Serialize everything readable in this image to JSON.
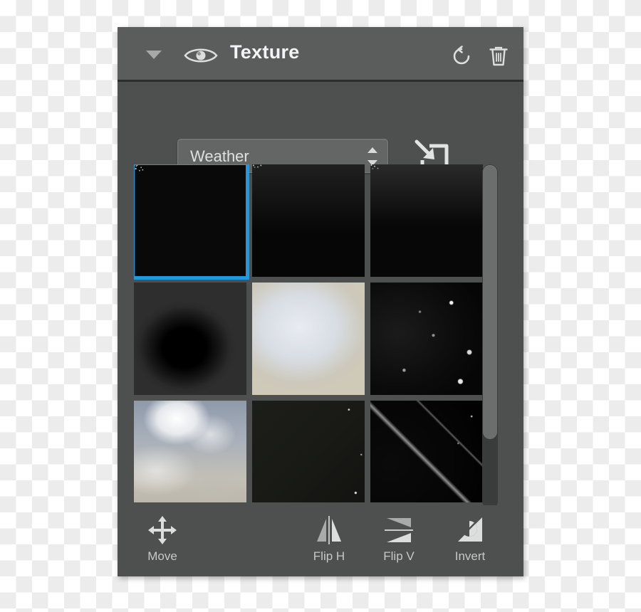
{
  "panel": {
    "header": {
      "title": "Texture",
      "disclosure_icon": "chevron-down-icon",
      "visibility_icon": "eye-icon",
      "reset_icon": "reset-icon",
      "delete_icon": "trash-icon"
    },
    "controls": {
      "preset_selected": "Weather",
      "preset_options": [
        "Weather"
      ],
      "stepper_icon": "stepper-arrows-icon",
      "import_icon": "import-texture-icon"
    },
    "grid": {
      "thumbnails": [
        {
          "name": "rain-dense",
          "selected": true
        },
        {
          "name": "rain-fade",
          "selected": false
        },
        {
          "name": "rain-streaks",
          "selected": false
        },
        {
          "name": "dark-blob",
          "selected": false
        },
        {
          "name": "paper-grain",
          "selected": false
        },
        {
          "name": "bokeh-specks",
          "selected": false
        },
        {
          "name": "clouds-sky",
          "selected": false
        },
        {
          "name": "dark-dust",
          "selected": false
        },
        {
          "name": "scratches",
          "selected": false
        }
      ]
    },
    "scrollbar": {
      "orientation": "vertical",
      "thumb_position_percent": 0,
      "thumb_size_percent": 80
    },
    "footer": {
      "tools": [
        {
          "label": "Move",
          "icon": "move-icon"
        },
        {
          "label": "Flip H",
          "icon": "flip-horizontal-icon"
        },
        {
          "label": "Flip V",
          "icon": "flip-vertical-icon"
        },
        {
          "label": "Invert",
          "icon": "invert-icon"
        }
      ]
    }
  },
  "colors": {
    "panel_body": "#4e5050",
    "panel_header": "#5b5d5d",
    "accent_selection": "#1c9ae2",
    "text_primary": "#f2f4f5",
    "text_secondary": "#c6c8c8"
  }
}
